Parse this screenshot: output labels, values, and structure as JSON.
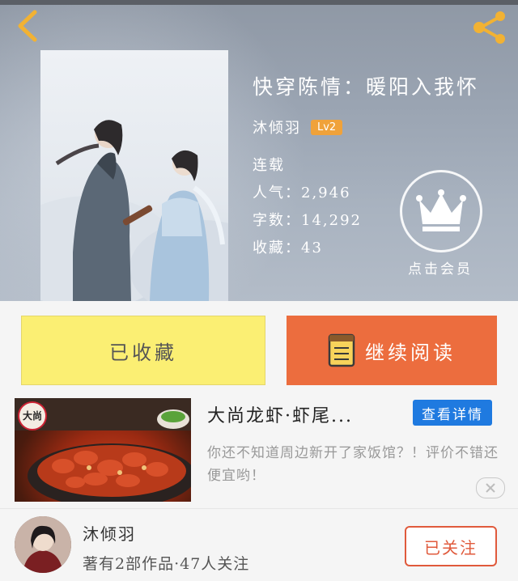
{
  "header": {
    "icons": {
      "back": "chevron-left-icon",
      "share": "share-icon"
    },
    "accent_color": "#f2b233"
  },
  "book": {
    "title": "快穿陈情：暖阳入我怀",
    "author": "沐倾羽",
    "author_level": "Lv2",
    "status": "连载",
    "popularity_label": "人气：",
    "popularity": "2,946",
    "word_count_label": "字数：",
    "word_count": "14,292",
    "favorites_label": "收藏：",
    "favorites": "43"
  },
  "vip": {
    "label": "点击会员",
    "icon": "crown-icon"
  },
  "actions": {
    "collected_label": "已收藏",
    "continue_reading_label": "继续阅读",
    "read_icon": "book-icon",
    "collected_color": "#fbef73",
    "read_color": "#ec6d3e"
  },
  "ad": {
    "title": "大尚龙虾·虾尾...",
    "detail_button": "查看详情",
    "description": "你还不知道周边新开了家饭馆？！评价不错还便宜哟！",
    "logo_text": "大尚",
    "detail_color": "#1f7ae0"
  },
  "author_footer": {
    "name": "沐倾羽",
    "stats": "著有2部作品·47人关注",
    "follow_label": "已关注",
    "follow_color": "#e05a3c"
  }
}
